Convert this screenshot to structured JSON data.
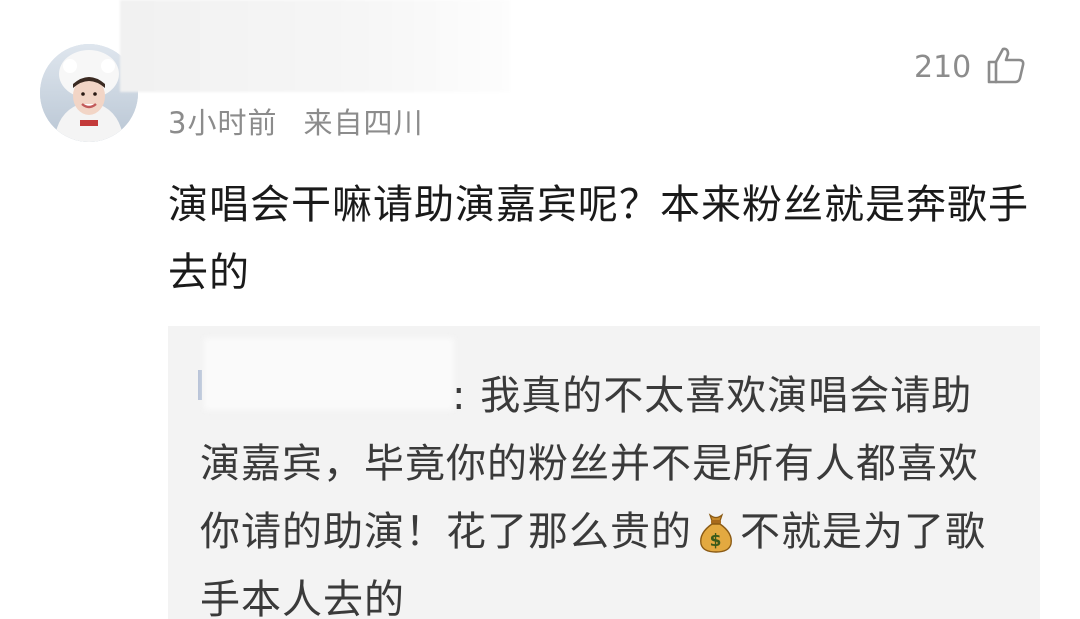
{
  "comment": {
    "time": "3小时前",
    "location": "来自四川",
    "likes": "210",
    "text": "演唱会干嘛请助演嘉宾呢？本来粉丝就是奔歌手去的"
  },
  "reply": {
    "separator": ":",
    "text_part1": "我真的不太喜欢演唱会请助演嘉宾，毕竟你的粉丝并不是所有人都喜欢你请的助演！花了那么贵的",
    "text_part2": "不就是为了歌手本人去的"
  },
  "icons": {
    "like": "thumbs-up-icon",
    "money": "money-bag-icon"
  },
  "colors": {
    "meta": "#8c8c8c",
    "text": "#1a1a1a",
    "reply_bg": "#f3f3f3"
  }
}
